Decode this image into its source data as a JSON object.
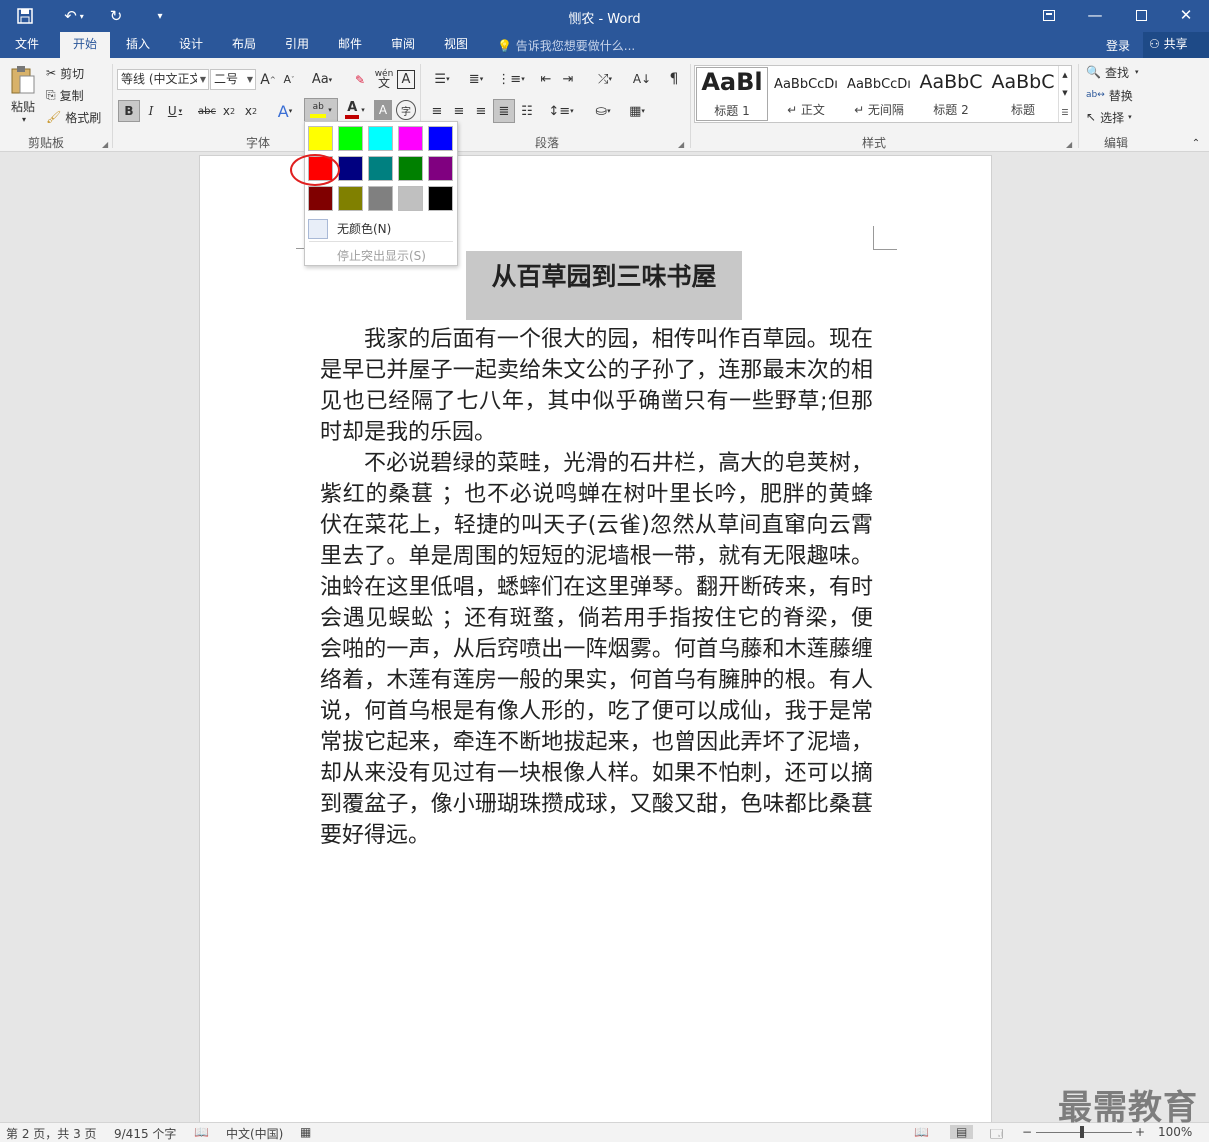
{
  "title": "恻农 - Word",
  "tabs": [
    "文件",
    "开始",
    "插入",
    "设计",
    "布局",
    "引用",
    "邮件",
    "审阅",
    "视图"
  ],
  "tell_me": "告诉我您想要做什么...",
  "login": "登录",
  "share": "共享",
  "clipboard": {
    "paste": "粘贴",
    "cut": "剪切",
    "copy": "复制",
    "format_painter": "格式刷",
    "group": "剪贴板"
  },
  "font": {
    "name": "等线 (中文正文)",
    "size": "二号",
    "group": "字体"
  },
  "paragraph": {
    "group": "段落"
  },
  "styles": {
    "group": "样式",
    "items": [
      {
        "preview": "AaBl",
        "name": "标题 1"
      },
      {
        "preview": "AaBbCcDı",
        "name": "↵ 正文"
      },
      {
        "preview": "AaBbCcDı",
        "name": "↵ 无间隔"
      },
      {
        "preview": "AaBbC",
        "name": "标题 2"
      },
      {
        "preview": "AaBbC",
        "name": "标题"
      }
    ]
  },
  "editing": {
    "find": "查找",
    "replace": "替换",
    "select": "选择",
    "group": "编辑"
  },
  "highlight_menu": {
    "colors": [
      [
        "#ffff00",
        "#00ff00",
        "#00ffff",
        "#ff00ff",
        "#0000ff"
      ],
      [
        "#ff0000",
        "#000080",
        "#008080",
        "#008000",
        "#800080"
      ],
      [
        "#800000",
        "#808000",
        "#808080",
        "#c0c0c0",
        "#000000"
      ]
    ],
    "no_color": "无颜色(N)",
    "stop": "停止突出显示(S)"
  },
  "document": {
    "heading": "从百草园到三味书屋",
    "paragraphs": [
      "我家的后面有一个很大的园，相传叫作百草园。现在是早已并屋子一起卖给朱文公的子孙了，连那最末次的相见也已经隔了七八年，其中似乎确凿只有一些野草;但那时却是我的乐园。",
      "不必说碧绿的菜畦，光滑的石井栏，高大的皂荚树，紫红的桑葚 ；也不必说鸣蝉在树叶里长吟，肥胖的黄蜂伏在菜花上，轻捷的叫天子(云雀)忽然从草间直窜向云霄里去了。单是周围的短短的泥墙根一带，就有无限趣味。油蛉在这里低唱，蟋蟀们在这里弹琴。翻开断砖来，有时会遇见蜈蚣 ；还有斑蝥，倘若用手指按住它的脊梁，便会啪的一声，从后窍喷出一阵烟雾。何首乌藤和木莲藤缠络着，木莲有莲房一般的果实，何首乌有臃肿的根。有人说，何首乌根是有像人形的，吃了便可以成仙，我于是常常拔它起来，牵连不断地拔起来，也曾因此弄坏了泥墙，却从来没有见过有一块根像人样。如果不怕刺，还可以摘到覆盆子，像小珊瑚珠攒成球，又酸又甜，色味都比桑葚要好得远。"
    ]
  },
  "status": {
    "page": "第 2 页，共 3 页",
    "words": "9/415 个字",
    "lang": "中文(中国)",
    "zoom": "100%"
  },
  "watermark": "最需教育"
}
